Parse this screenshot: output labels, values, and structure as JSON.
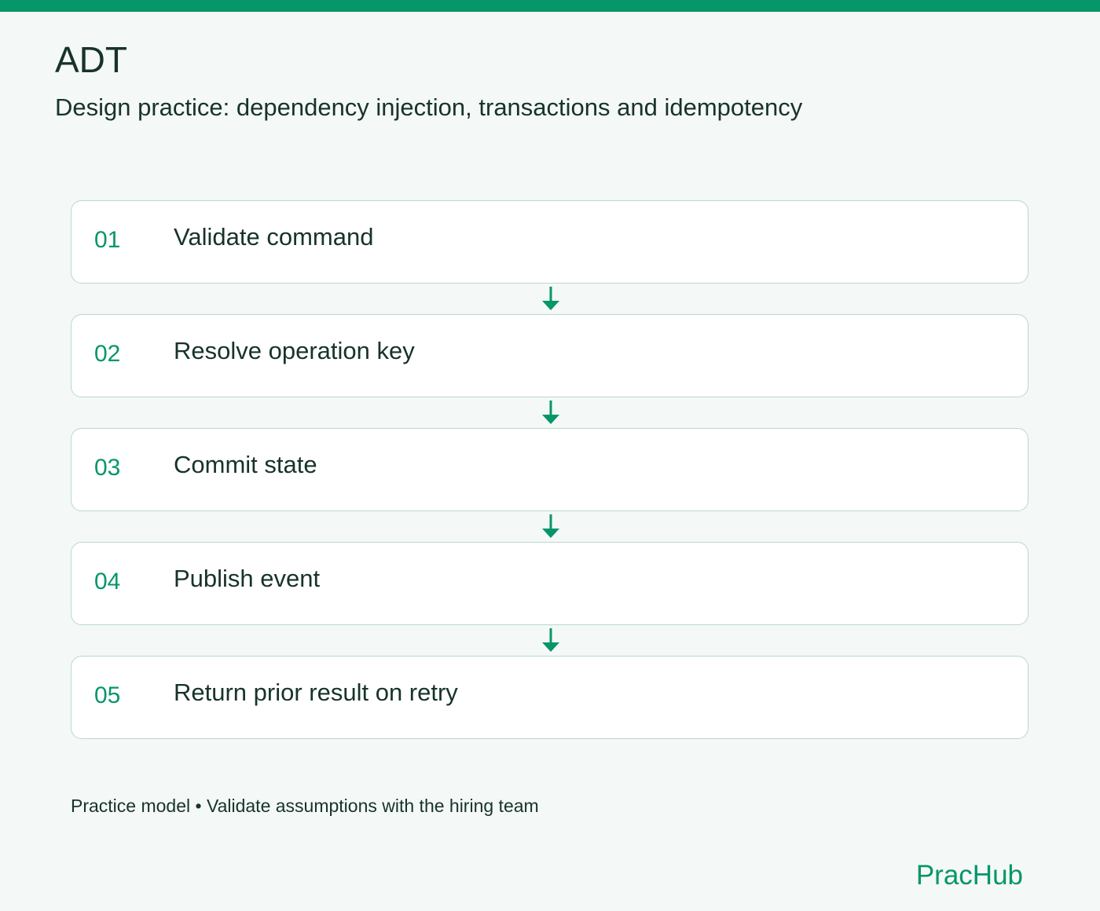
{
  "header": {
    "title": "ADT",
    "subtitle": "Design practice: dependency injection, transactions and idempotency"
  },
  "steps": [
    {
      "number": "01",
      "label": "Validate command"
    },
    {
      "number": "02",
      "label": "Resolve operation key"
    },
    {
      "number": "03",
      "label": "Commit state"
    },
    {
      "number": "04",
      "label": "Publish event"
    },
    {
      "number": "05",
      "label": "Return prior result on retry"
    }
  ],
  "footer": {
    "note": "Practice model • Validate assumptions with the hiring team",
    "brand": "PracHub"
  },
  "colors": {
    "accent": "#05966a",
    "text": "#17332b",
    "background": "#f4f8f6",
    "card_border": "#b9d9cd"
  }
}
